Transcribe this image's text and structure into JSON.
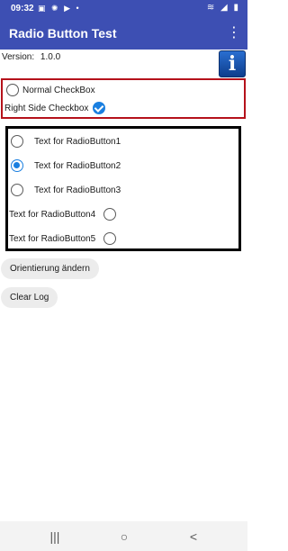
{
  "status_bar": {
    "time": "09:32",
    "left_icons": [
      "image-icon",
      "weather-icon",
      "youtube-icon",
      "dot-icon"
    ],
    "right_icons": [
      "wifi-icon",
      "signal-icon",
      "battery-icon"
    ]
  },
  "app_bar": {
    "title": "Radio Button Test",
    "menu_icon": "more-vert-icon",
    "color": "#3d4fb3"
  },
  "version": {
    "label": "Version:",
    "value": "1.0.0"
  },
  "info_icon": {
    "glyph": "i"
  },
  "checkboxes": {
    "border_color": "#b5121b",
    "items": [
      {
        "label": "Normal CheckBox",
        "checked": false
      },
      {
        "label": "Right Side Checkbox",
        "checked": true
      }
    ]
  },
  "radio_group": {
    "border_color": "#000000",
    "accent": "#1a7fe0",
    "items": [
      {
        "label": "Text for RadioButton1",
        "selected": false
      },
      {
        "label": "Text for RadioButton2",
        "selected": true
      },
      {
        "label": "Text for RadioButton3",
        "selected": false
      },
      {
        "label": "Text for RadioButton4",
        "selected": false
      },
      {
        "label": "Text for RadioButton5",
        "selected": false
      }
    ]
  },
  "buttons": {
    "orientation": "Orientierung ändern",
    "clear_log": "Clear Log"
  },
  "nav_bar": {
    "recents": "|||",
    "home": "○",
    "back": "<"
  }
}
